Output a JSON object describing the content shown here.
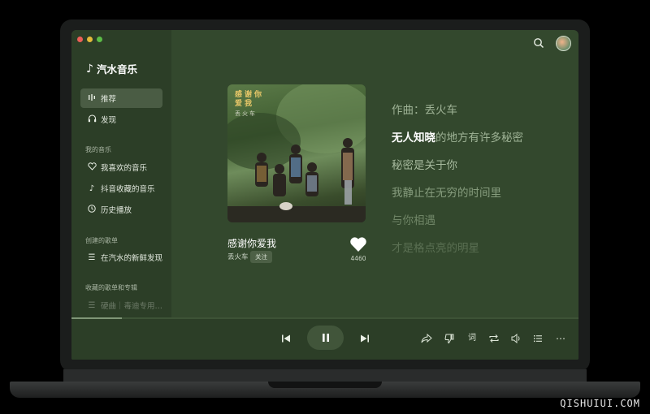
{
  "app": {
    "name": "汽水音乐"
  },
  "nav": {
    "primary": [
      {
        "label": "推荐",
        "icon": "recommend-icon"
      },
      {
        "label": "发现",
        "icon": "headphones-icon"
      }
    ],
    "my_music_label": "我的音乐",
    "my_music": [
      {
        "label": "我喜欢的音乐",
        "icon": "heart-icon"
      },
      {
        "label": "抖音收藏的音乐",
        "icon": "douyin-icon"
      },
      {
        "label": "历史播放",
        "icon": "clock-icon"
      }
    ],
    "created_label": "创建的歌单",
    "created": [
      {
        "label": "在汽水的新鲜发现",
        "icon": "list-icon"
      }
    ],
    "collected_label": "收藏的歌单和专辑",
    "collected": [
      {
        "label": "硬曲｜毒迪专用…",
        "icon": "list-icon"
      }
    ]
  },
  "song": {
    "cover_title": "感谢你爱我",
    "cover_artist": "丢火车",
    "title": "感谢你爱我",
    "artist": "丢火车",
    "follow_label": "关注",
    "like_count": "4460"
  },
  "lyrics": {
    "composer": "作曲：丢火车",
    "current_sung": "无人知晓",
    "current_rest": "的地方有许多秘密",
    "lines_after": [
      "秘密是关于你",
      "我静止在无穷的时间里",
      "与你相遇",
      "才是格点亮的明星"
    ]
  },
  "player": {
    "progress": 0.1
  },
  "colors": {
    "screen_bg": "#33482d",
    "sidebar_bg": "#2c3e27",
    "active_item": "#4a5c44"
  },
  "watermark": "QISHUIUI.COM"
}
